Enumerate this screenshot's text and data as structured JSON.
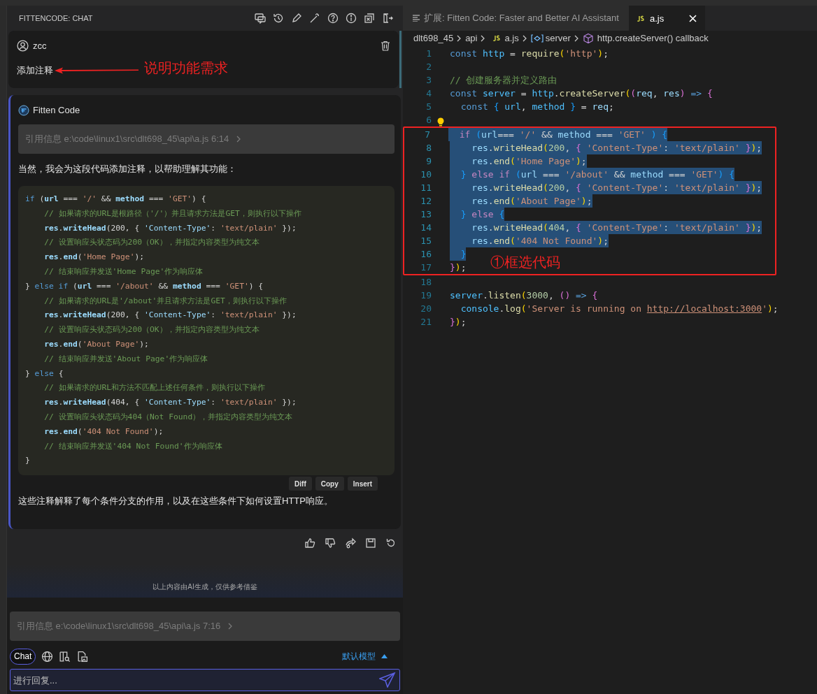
{
  "panel": {
    "title": "FITTENCODE: CHAT"
  },
  "user_message": {
    "user": "zcc",
    "text": "添加注释",
    "annotation": "说明功能需求"
  },
  "assistant_message": {
    "author": "Fitten Code",
    "reference": "引用信息 e:\\code\\linux1\\src\\dlt698_45\\api\\a.js 6:14",
    "intro": "当然，我会为这段代码添加注释，以帮助理解其功能：",
    "code": [
      [
        {
          "kind": "kw",
          "text": "if "
        },
        {
          "kind": "p",
          "text": "("
        },
        {
          "kind": "var",
          "text": "url"
        },
        {
          "kind": "p",
          "text": " === "
        },
        {
          "kind": "str",
          "text": "'/'"
        },
        {
          "kind": "p",
          "text": " && "
        },
        {
          "kind": "var",
          "text": "method"
        },
        {
          "kind": "p",
          "text": " === "
        },
        {
          "kind": "str",
          "text": "'GET'"
        },
        {
          "kind": "p",
          "text": ") {"
        }
      ],
      [
        {
          "kind": "cmt",
          "text": "    // 如果请求的URL是根路径（'/'）并且请求方法是GET，则执行以下操作"
        }
      ],
      [
        {
          "kind": "var",
          "text": "    res"
        },
        {
          "kind": "p",
          "text": "."
        },
        {
          "kind": "var",
          "text": "writeHead"
        },
        {
          "kind": "p",
          "text": "(200, { "
        },
        {
          "kind": "str2",
          "text": "'Content-Type'"
        },
        {
          "kind": "p",
          "text": ": "
        },
        {
          "kind": "str",
          "text": "'text/plain'"
        },
        {
          "kind": "p",
          "text": " });"
        }
      ],
      [
        {
          "kind": "cmt",
          "text": "    // 设置响应头状态码为200（OK），并指定内容类型为纯文本"
        }
      ],
      [
        {
          "kind": "var",
          "text": "    res"
        },
        {
          "kind": "p",
          "text": "."
        },
        {
          "kind": "var",
          "text": "end"
        },
        {
          "kind": "p",
          "text": "("
        },
        {
          "kind": "str",
          "text": "'Home Page'"
        },
        {
          "kind": "p",
          "text": ");"
        }
      ],
      [
        {
          "kind": "cmt",
          "text": "    // 结束响应并发送'Home Page'作为响应体"
        }
      ],
      [
        {
          "kind": "p",
          "text": "} "
        },
        {
          "kind": "kw",
          "text": "else if "
        },
        {
          "kind": "p",
          "text": "("
        },
        {
          "kind": "var",
          "text": "url"
        },
        {
          "kind": "p",
          "text": " === "
        },
        {
          "kind": "str",
          "text": "'/about'"
        },
        {
          "kind": "p",
          "text": " && "
        },
        {
          "kind": "var",
          "text": "method"
        },
        {
          "kind": "p",
          "text": " === "
        },
        {
          "kind": "str",
          "text": "'GET'"
        },
        {
          "kind": "p",
          "text": ") {"
        }
      ],
      [
        {
          "kind": "cmt",
          "text": "    // 如果请求的URL是'/about'并且请求方法是GET，则执行以下操作"
        }
      ],
      [
        {
          "kind": "var",
          "text": "    res"
        },
        {
          "kind": "p",
          "text": "."
        },
        {
          "kind": "var",
          "text": "writeHead"
        },
        {
          "kind": "p",
          "text": "(200, { "
        },
        {
          "kind": "str2",
          "text": "'Content-Type'"
        },
        {
          "kind": "p",
          "text": ": "
        },
        {
          "kind": "str",
          "text": "'text/plain'"
        },
        {
          "kind": "p",
          "text": " });"
        }
      ],
      [
        {
          "kind": "cmt",
          "text": "    // 设置响应头状态码为200（OK），并指定内容类型为纯文本"
        }
      ],
      [
        {
          "kind": "var",
          "text": "    res"
        },
        {
          "kind": "p",
          "text": "."
        },
        {
          "kind": "var",
          "text": "end"
        },
        {
          "kind": "p",
          "text": "("
        },
        {
          "kind": "str",
          "text": "'About Page'"
        },
        {
          "kind": "p",
          "text": ");"
        }
      ],
      [
        {
          "kind": "cmt",
          "text": "    // 结束响应并发送'About Page'作为响应体"
        }
      ],
      [
        {
          "kind": "p",
          "text": "} "
        },
        {
          "kind": "kw",
          "text": "else "
        },
        {
          "kind": "p",
          "text": "{"
        }
      ],
      [
        {
          "kind": "cmt",
          "text": "    // 如果请求的URL和方法不匹配上述任何条件，则执行以下操作"
        }
      ],
      [
        {
          "kind": "var",
          "text": "    res"
        },
        {
          "kind": "p",
          "text": "."
        },
        {
          "kind": "var",
          "text": "writeHead"
        },
        {
          "kind": "p",
          "text": "(404, { "
        },
        {
          "kind": "str2",
          "text": "'Content-Type'"
        },
        {
          "kind": "p",
          "text": ": "
        },
        {
          "kind": "str",
          "text": "'text/plain'"
        },
        {
          "kind": "p",
          "text": " });"
        }
      ],
      [
        {
          "kind": "cmt",
          "text": "    // 设置响应头状态码为404（Not Found），并指定内容类型为纯文本"
        }
      ],
      [
        {
          "kind": "var",
          "text": "    res"
        },
        {
          "kind": "p",
          "text": "."
        },
        {
          "kind": "var",
          "text": "end"
        },
        {
          "kind": "p",
          "text": "("
        },
        {
          "kind": "str",
          "text": "'404 Not Found'"
        },
        {
          "kind": "p",
          "text": ");"
        }
      ],
      [
        {
          "kind": "cmt",
          "text": "    // 结束响应并发送'404 Not Found'作为响应体"
        }
      ],
      [
        {
          "kind": "p",
          "text": "}"
        }
      ]
    ],
    "code_actions": [
      "Diff",
      "Copy",
      "Insert"
    ],
    "outro": "这些注释解释了每个条件分支的作用，以及在这些条件下如何设置HTTP响应。"
  },
  "disclaimer": "以上内容由AI生成，仅供参考借鉴",
  "composer": {
    "reference": "引用信息 e:\\code\\linux1\\src\\dlt698_45\\api\\a.js 7:16",
    "mode": "Chat",
    "model": "默认模型",
    "placeholder": "进行回复..."
  },
  "editor": {
    "tabs": [
      {
        "label": "扩展: Fitten Code: Faster and Better AI Assistant",
        "kind": "preview",
        "selected": false
      },
      {
        "label": "a.js",
        "kind": "js",
        "selected": true
      }
    ],
    "breadcrumb": [
      {
        "label": "dlt698_45",
        "kind": "folder"
      },
      {
        "label": "api",
        "kind": "folder"
      },
      {
        "label": "a.js",
        "kind": "js"
      },
      {
        "label": "server",
        "kind": "variable"
      },
      {
        "label": "http.createServer() callback",
        "kind": "method"
      }
    ],
    "annotation": "①框选代码",
    "lines": [
      {
        "number": "1",
        "selected": false,
        "boxed": false,
        "tokens": [
          {
            "kind": "kw",
            "text": "const "
          },
          {
            "kind": "var2",
            "text": "http"
          },
          {
            "kind": "p",
            "text": " = "
          },
          {
            "kind": "fn",
            "text": "require"
          },
          {
            "kind": "b1",
            "text": "("
          },
          {
            "kind": "str",
            "text": "'http'"
          },
          {
            "kind": "b1",
            "text": ")"
          },
          {
            "kind": "p",
            "text": ";"
          }
        ]
      },
      {
        "number": "2",
        "selected": false,
        "boxed": false
      },
      {
        "number": "3",
        "selected": false,
        "boxed": false,
        "tokens": [
          {
            "kind": "cmt",
            "text": "// 创建服务器并定义路由"
          }
        ]
      },
      {
        "number": "4",
        "selected": false,
        "boxed": false,
        "tokens": [
          {
            "kind": "kw",
            "text": "const "
          },
          {
            "kind": "var2",
            "text": "server"
          },
          {
            "kind": "p",
            "text": " = "
          },
          {
            "kind": "var2",
            "text": "http"
          },
          {
            "kind": "p",
            "text": "."
          },
          {
            "kind": "fn",
            "text": "createServer"
          },
          {
            "kind": "b1",
            "text": "("
          },
          {
            "kind": "b2",
            "text": "("
          },
          {
            "kind": "var",
            "text": "req"
          },
          {
            "kind": "p",
            "text": ", "
          },
          {
            "kind": "var",
            "text": "res"
          },
          {
            "kind": "b2",
            "text": ")"
          },
          {
            "kind": "kw",
            "text": " => "
          },
          {
            "kind": "b2",
            "text": "{"
          }
        ]
      },
      {
        "number": "5",
        "selected": false,
        "boxed": false,
        "tokens": [
          {
            "kind": "kw",
            "text": "  const "
          },
          {
            "kind": "b3",
            "text": "{ "
          },
          {
            "kind": "var2",
            "text": "url"
          },
          {
            "kind": "p",
            "text": ", "
          },
          {
            "kind": "var2",
            "text": "method"
          },
          {
            "kind": "b3",
            "text": " }"
          },
          {
            "kind": "p",
            "text": " = "
          },
          {
            "kind": "var",
            "text": "req"
          },
          {
            "kind": "p",
            "text": ";"
          }
        ]
      },
      {
        "number": "6",
        "selected": false,
        "boxed": false,
        "hint": true
      },
      {
        "number": "7",
        "selected": true,
        "boxed": true,
        "tokens": [
          {
            "kind": "ctl",
            "text": "  if "
          },
          {
            "kind": "b3",
            "text": "("
          },
          {
            "kind": "var",
            "text": "url"
          },
          {
            "kind": "p",
            "text": "=== "
          },
          {
            "kind": "str",
            "text": "'/'"
          },
          {
            "kind": "p",
            "text": " && "
          },
          {
            "kind": "var",
            "text": "method"
          },
          {
            "kind": "p",
            "text": " === "
          },
          {
            "kind": "str",
            "text": "'GET'"
          },
          {
            "kind": "b3",
            "text": " ) {"
          }
        ]
      },
      {
        "number": "8",
        "selected": true,
        "boxed": true,
        "tokens": [
          {
            "kind": "var",
            "text": "    res"
          },
          {
            "kind": "p",
            "text": "."
          },
          {
            "kind": "fn",
            "text": "writeHead"
          },
          {
            "kind": "b1",
            "text": "("
          },
          {
            "kind": "num",
            "text": "200"
          },
          {
            "kind": "p",
            "text": ", "
          },
          {
            "kind": "b2",
            "text": "{ "
          },
          {
            "kind": "str",
            "text": "'Content-Type'"
          },
          {
            "kind": "p",
            "text": ": "
          },
          {
            "kind": "str",
            "text": "'text/plain'"
          },
          {
            "kind": "b2",
            "text": " }"
          },
          {
            "kind": "b1",
            "text": ")"
          },
          {
            "kind": "p",
            "text": ";"
          }
        ]
      },
      {
        "number": "9",
        "selected": true,
        "boxed": true,
        "tokens": [
          {
            "kind": "var",
            "text": "    res"
          },
          {
            "kind": "p",
            "text": "."
          },
          {
            "kind": "fn",
            "text": "end"
          },
          {
            "kind": "b1",
            "text": "("
          },
          {
            "kind": "str",
            "text": "'Home Page'"
          },
          {
            "kind": "b1",
            "text": ")"
          },
          {
            "kind": "p",
            "text": ";"
          }
        ]
      },
      {
        "number": "10",
        "selected": true,
        "boxed": true,
        "tokens": [
          {
            "kind": "b3",
            "text": "  } "
          },
          {
            "kind": "ctl",
            "text": "else if "
          },
          {
            "kind": "b3",
            "text": "("
          },
          {
            "kind": "var",
            "text": "url"
          },
          {
            "kind": "p",
            "text": " === "
          },
          {
            "kind": "str",
            "text": "'/about'"
          },
          {
            "kind": "p",
            "text": " && "
          },
          {
            "kind": "var",
            "text": "method"
          },
          {
            "kind": "p",
            "text": " === "
          },
          {
            "kind": "str",
            "text": "'GET'"
          },
          {
            "kind": "b3",
            "text": ") {"
          }
        ]
      },
      {
        "number": "11",
        "selected": true,
        "boxed": true,
        "tokens": [
          {
            "kind": "var",
            "text": "    res"
          },
          {
            "kind": "p",
            "text": "."
          },
          {
            "kind": "fn",
            "text": "writeHead"
          },
          {
            "kind": "b1",
            "text": "("
          },
          {
            "kind": "num",
            "text": "200"
          },
          {
            "kind": "p",
            "text": ", "
          },
          {
            "kind": "b2",
            "text": "{ "
          },
          {
            "kind": "str",
            "text": "'Content-Type'"
          },
          {
            "kind": "p",
            "text": ": "
          },
          {
            "kind": "str",
            "text": "'text/plain'"
          },
          {
            "kind": "b2",
            "text": " }"
          },
          {
            "kind": "b1",
            "text": ")"
          },
          {
            "kind": "p",
            "text": ";"
          }
        ]
      },
      {
        "number": "12",
        "selected": true,
        "boxed": true,
        "tokens": [
          {
            "kind": "var",
            "text": "    res"
          },
          {
            "kind": "p",
            "text": "."
          },
          {
            "kind": "fn",
            "text": "end"
          },
          {
            "kind": "b1",
            "text": "("
          },
          {
            "kind": "str",
            "text": "'About Page'"
          },
          {
            "kind": "b1",
            "text": ")"
          },
          {
            "kind": "p",
            "text": ";"
          }
        ]
      },
      {
        "number": "13",
        "selected": true,
        "boxed": true,
        "tokens": [
          {
            "kind": "b3",
            "text": "  } "
          },
          {
            "kind": "ctl",
            "text": "else "
          },
          {
            "kind": "b3",
            "text": "{"
          }
        ]
      },
      {
        "number": "14",
        "selected": true,
        "boxed": true,
        "tokens": [
          {
            "kind": "var",
            "text": "    res"
          },
          {
            "kind": "p",
            "text": "."
          },
          {
            "kind": "fn",
            "text": "writeHead"
          },
          {
            "kind": "b1",
            "text": "("
          },
          {
            "kind": "num",
            "text": "404"
          },
          {
            "kind": "p",
            "text": ", "
          },
          {
            "kind": "b2",
            "text": "{ "
          },
          {
            "kind": "str",
            "text": "'Content-Type'"
          },
          {
            "kind": "p",
            "text": ": "
          },
          {
            "kind": "str",
            "text": "'text/plain'"
          },
          {
            "kind": "b2",
            "text": " }"
          },
          {
            "kind": "b1",
            "text": ")"
          },
          {
            "kind": "p",
            "text": ";"
          }
        ]
      },
      {
        "number": "15",
        "selected": true,
        "boxed": true,
        "tokens": [
          {
            "kind": "var",
            "text": "    res"
          },
          {
            "kind": "p",
            "text": "."
          },
          {
            "kind": "fn",
            "text": "end"
          },
          {
            "kind": "b1",
            "text": "("
          },
          {
            "kind": "str",
            "text": "'404 Not Found'"
          },
          {
            "kind": "b1",
            "text": ")"
          },
          {
            "kind": "p",
            "text": ";"
          }
        ]
      },
      {
        "number": "16",
        "selected": true,
        "boxed": true,
        "tokens": [
          {
            "kind": "b3",
            "text": "  }"
          }
        ]
      },
      {
        "number": "17",
        "selected": false,
        "boxed": true,
        "tokens": [
          {
            "kind": "b2",
            "text": "}"
          },
          {
            "kind": "b1",
            "text": ")"
          },
          {
            "kind": "p",
            "text": ";"
          }
        ]
      },
      {
        "number": "18",
        "selected": false,
        "boxed": false
      },
      {
        "number": "19",
        "selected": false,
        "boxed": false,
        "tokens": [
          {
            "kind": "var2",
            "text": "server"
          },
          {
            "kind": "p",
            "text": "."
          },
          {
            "kind": "fn",
            "text": "listen"
          },
          {
            "kind": "b1",
            "text": "("
          },
          {
            "kind": "num",
            "text": "3000"
          },
          {
            "kind": "p",
            "text": ", "
          },
          {
            "kind": "b2",
            "text": "()"
          },
          {
            "kind": "kw",
            "text": " => "
          },
          {
            "kind": "b2",
            "text": "{"
          }
        ]
      },
      {
        "number": "20",
        "selected": false,
        "boxed": false,
        "tokens": [
          {
            "kind": "var2",
            "text": "  console"
          },
          {
            "kind": "p",
            "text": "."
          },
          {
            "kind": "fn",
            "text": "log"
          },
          {
            "kind": "b1",
            "text": "("
          },
          {
            "kind": "str",
            "text": "'Server is running on "
          },
          {
            "kind": "link",
            "text": "http://localhost:3000"
          },
          {
            "kind": "str",
            "text": "'"
          },
          {
            "kind": "b1",
            "text": ")"
          },
          {
            "kind": "p",
            "text": ";"
          }
        ]
      },
      {
        "number": "21",
        "selected": false,
        "boxed": false,
        "tokens": [
          {
            "kind": "b2",
            "text": "}"
          },
          {
            "kind": "b1",
            "text": ")"
          },
          {
            "kind": "p",
            "text": ";"
          }
        ]
      }
    ]
  }
}
